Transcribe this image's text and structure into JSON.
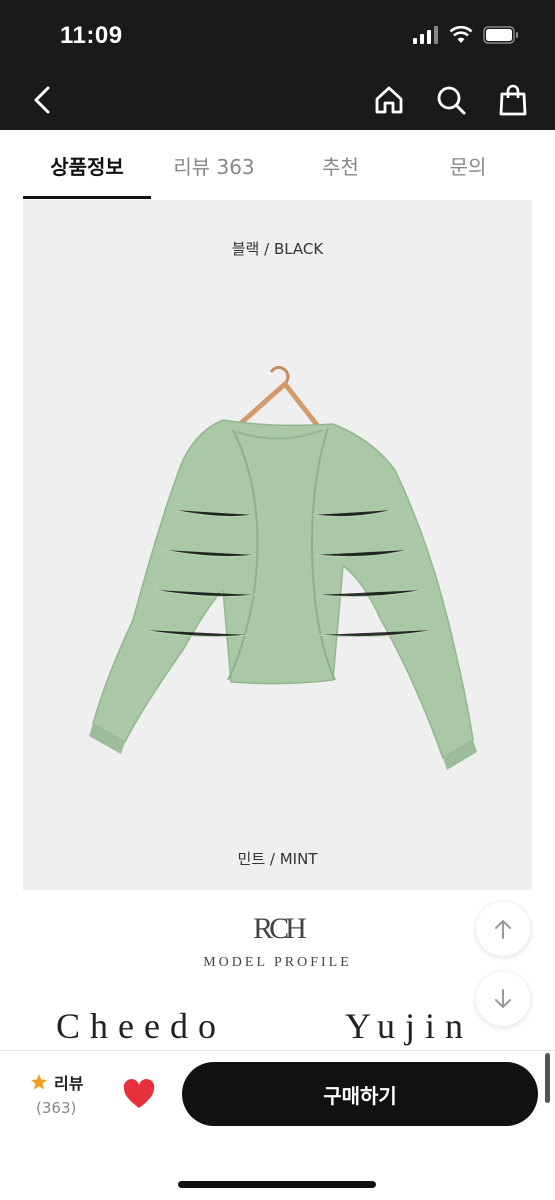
{
  "status_bar": {
    "time": "11:09"
  },
  "tabs": [
    {
      "label": "상품정보",
      "active": true
    },
    {
      "label": "리뷰 363",
      "active": false
    },
    {
      "label": "추천",
      "active": false
    },
    {
      "label": "문의",
      "active": false
    }
  ],
  "product": {
    "color_top": "블랙 / BLACK",
    "color_bottom": "민트 / MINT",
    "garment_color": "#a9c8a6"
  },
  "brand": {
    "logo_text": "RCH",
    "subtitle": "MODEL PROFILE",
    "model_left": "Cheedo",
    "model_right": "Yujin"
  },
  "bottom_bar": {
    "review_label": "리뷰",
    "review_count": "(363)",
    "buy_label": "구매하기"
  },
  "colors": {
    "accent": "#111111",
    "star": "#f0a020",
    "heart": "#e8303a"
  }
}
